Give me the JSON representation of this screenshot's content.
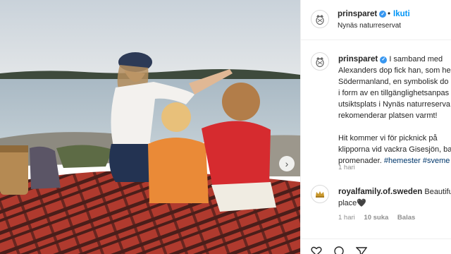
{
  "post": {
    "username": "prinsparet",
    "verified_mark": "✓",
    "separator": "•",
    "follow_label": "Ikuti",
    "location": "Nynäs naturreservat"
  },
  "caption": {
    "lines": [
      "I samband med",
      "Alexanders dop fick han, som he",
      "Södermanland, en symbolisk do",
      "i form av en tillgänglighetsanpas",
      "utsiktsplats i Nynäs naturreserva",
      "rekomenderar platsen varmt!",
      "",
      "Hit kommer vi för picknick på",
      "klipporna vid vackra Gisesjön, ba",
      "promenader."
    ],
    "hashtags": [
      "#hemester",
      "#sveme"
    ],
    "time": "1 hari"
  },
  "comment": {
    "username": "royalfamily.of.sweden",
    "text_line1": "Beautiful",
    "text_line2": "place",
    "emoji": "🖤",
    "time": "1 hari",
    "likes": "10 suka",
    "reply_label": "Balas"
  },
  "icons": {
    "avatar": "royal-crest-icon",
    "comment_avatar": "crown-icon",
    "photo_next": "chevron-right-icon",
    "like": "heart-icon",
    "comment": "comment-icon",
    "share": "share-icon"
  },
  "colors": {
    "link": "#0095f6",
    "verified": "#3897f0",
    "hashtag": "#00376b",
    "muted": "#8e8e8e"
  }
}
